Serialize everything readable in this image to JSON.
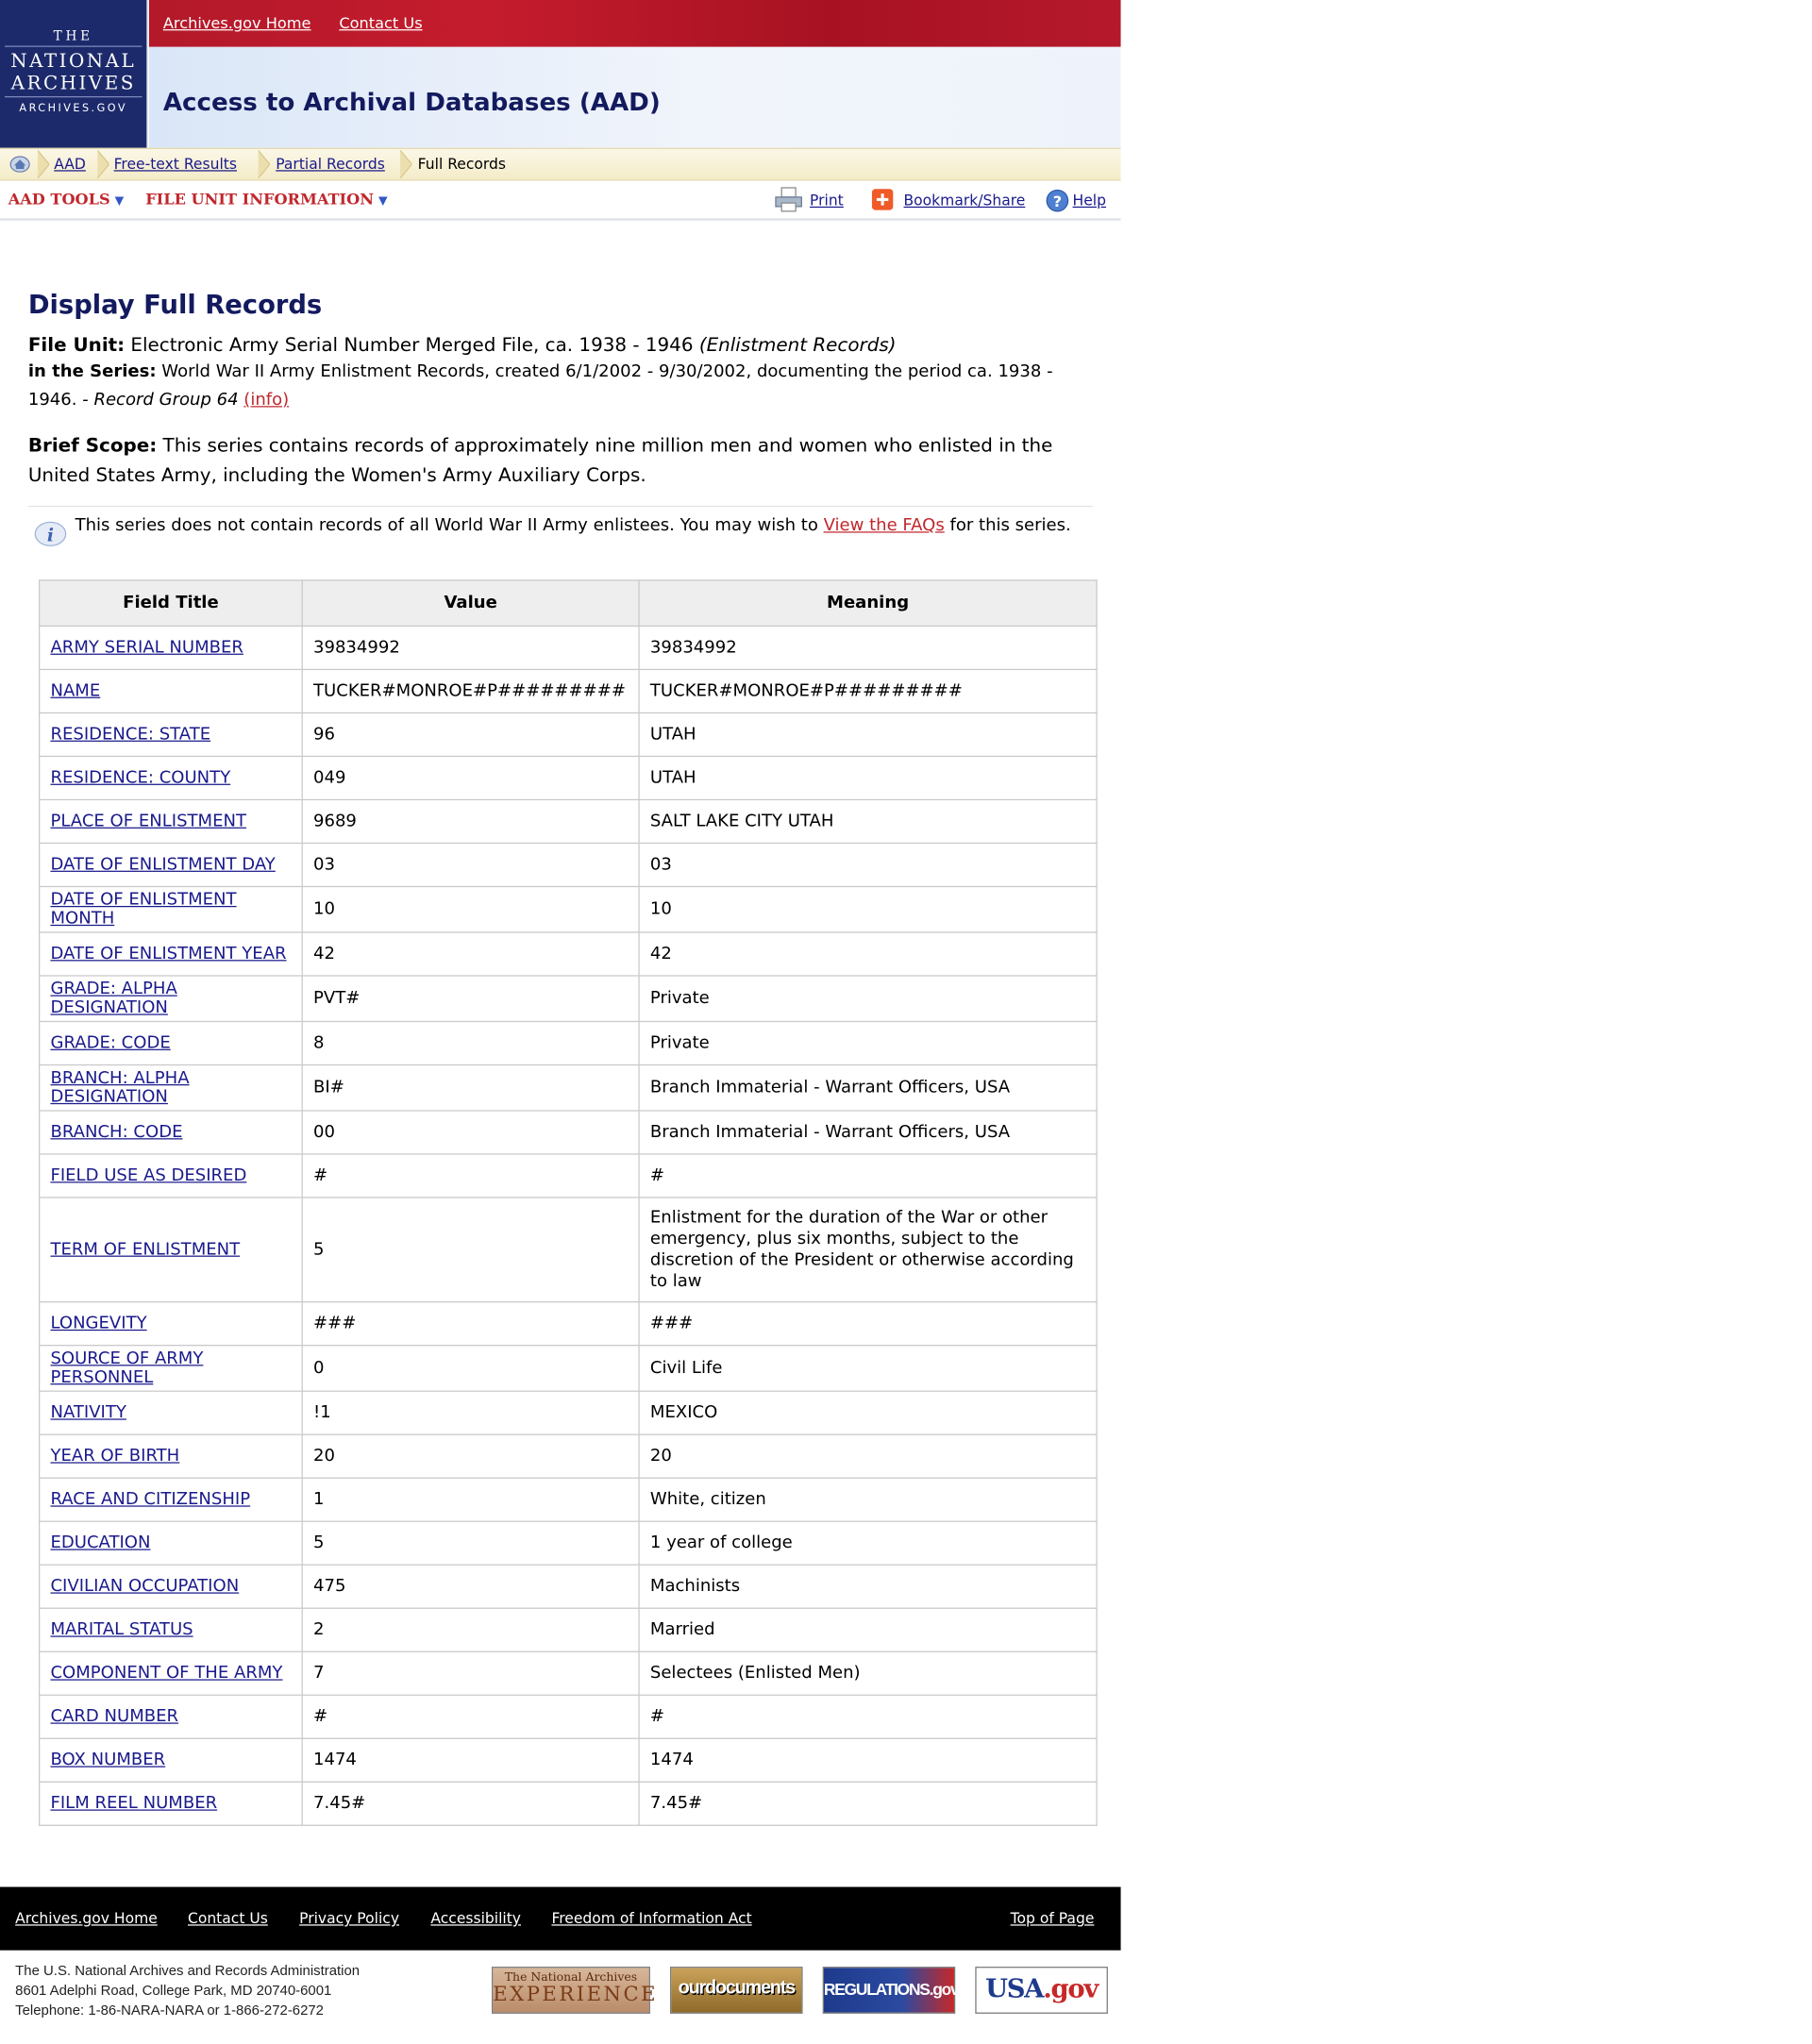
{
  "header": {
    "logo": {
      "line1": "THE",
      "line2a": "NATIONAL",
      "line2b": "ARCHIVES",
      "line3": "ARCHIVES.GOV"
    },
    "top_links": [
      "Archives.gov Home",
      "Contact Us"
    ],
    "site_title": "Access to Archival Databases (AAD)"
  },
  "breadcrumb": [
    "AAD",
    "Free-text Results",
    "Partial Records",
    "Full Records"
  ],
  "toolbar": {
    "aad_tools": "AAD TOOLS",
    "file_unit_info": "FILE UNIT INFORMATION",
    "print": "Print",
    "bookmark": "Bookmark/Share",
    "help": "Help"
  },
  "page": {
    "heading": "Display Full Records",
    "file_unit_label": "File Unit:",
    "file_unit_text": "Electronic Army Serial Number Merged File, ca. 1938 - 1946",
    "file_unit_italic": "(Enlistment Records)",
    "series_label": "in the Series:",
    "series_text": "World War II Army Enlistment Records, created 6/1/2002 - 9/30/2002, documenting the period ca. 1938 - 1946. -",
    "series_italic": "Record Group 64",
    "info_link": "(info)",
    "scope_label": "Brief Scope:",
    "scope_text": "This series contains records of approximately nine million men and women who enlisted in the United States Army, including the Women's Army Auxiliary Corps.",
    "note_before": "This series does not contain records of all World War II Army enlistees. You may wish to",
    "note_link": "View the FAQs",
    "note_after": "for this series."
  },
  "table": {
    "headers": [
      "Field Title",
      "Value",
      "Meaning"
    ],
    "rows": [
      {
        "field": "ARMY SERIAL NUMBER",
        "value": "39834992",
        "meaning": "39834992"
      },
      {
        "field": "NAME",
        "value": "TUCKER#MONROE#P#########",
        "meaning": "TUCKER#MONROE#P#########"
      },
      {
        "field": "RESIDENCE: STATE",
        "value": "96",
        "meaning": "UTAH"
      },
      {
        "field": "RESIDENCE: COUNTY",
        "value": "049",
        "meaning": "UTAH"
      },
      {
        "field": "PLACE OF ENLISTMENT",
        "value": "9689",
        "meaning": "SALT LAKE CITY UTAH"
      },
      {
        "field": "DATE OF ENLISTMENT DAY",
        "value": "03",
        "meaning": "03"
      },
      {
        "field": "DATE OF ENLISTMENT MONTH",
        "value": "10",
        "meaning": "10"
      },
      {
        "field": "DATE OF ENLISTMENT YEAR",
        "value": "42",
        "meaning": "42"
      },
      {
        "field": "GRADE: ALPHA DESIGNATION",
        "value": "PVT#",
        "meaning": "Private"
      },
      {
        "field": "GRADE: CODE",
        "value": "8",
        "meaning": "Private"
      },
      {
        "field": "BRANCH: ALPHA DESIGNATION",
        "value": "BI#",
        "meaning": "Branch Immaterial - Warrant Officers, USA"
      },
      {
        "field": "BRANCH: CODE",
        "value": "00",
        "meaning": "Branch Immaterial - Warrant Officers, USA"
      },
      {
        "field": "FIELD USE AS DESIRED",
        "value": "#",
        "meaning": "#"
      },
      {
        "field": "TERM OF ENLISTMENT",
        "value": "5",
        "meaning": "Enlistment for the duration of the War or other emergency, plus six months, subject to the discretion of the President or otherwise according to law"
      },
      {
        "field": "LONGEVITY",
        "value": "###",
        "meaning": "###"
      },
      {
        "field": "SOURCE OF ARMY PERSONNEL",
        "value": "0",
        "meaning": "Civil Life"
      },
      {
        "field": "NATIVITY",
        "value": "!1",
        "meaning": "MEXICO"
      },
      {
        "field": "YEAR OF BIRTH",
        "value": "20",
        "meaning": "20"
      },
      {
        "field": "RACE AND CITIZENSHIP",
        "value": "1",
        "meaning": "White, citizen"
      },
      {
        "field": "EDUCATION",
        "value": "5",
        "meaning": "1 year of college"
      },
      {
        "field": "CIVILIAN OCCUPATION",
        "value": "475",
        "meaning": "Machinists"
      },
      {
        "field": "MARITAL STATUS",
        "value": "2",
        "meaning": "Married"
      },
      {
        "field": "COMPONENT OF THE ARMY",
        "value": "7",
        "meaning": "Selectees (Enlisted Men)"
      },
      {
        "field": "CARD NUMBER",
        "value": "#",
        "meaning": "#"
      },
      {
        "field": "BOX NUMBER",
        "value": "1474",
        "meaning": "1474"
      },
      {
        "field": "FILM REEL NUMBER",
        "value": "7.45#",
        "meaning": "7.45#"
      }
    ]
  },
  "footer": {
    "links": [
      "Archives.gov Home",
      "Contact Us",
      "Privacy Policy",
      "Accessibility",
      "Freedom of Information Act"
    ],
    "top_of_page": "Top of Page",
    "address": [
      "The U.S. National Archives and Records Administration",
      "8601 Adelphi Road, College Park, MD 20740-6001",
      "Telephone: 1-86-NARA-NARA or 1-866-272-6272"
    ],
    "badges": {
      "experience_top": "The National Archives",
      "experience_bottom": "EXPERIENCE",
      "ourdocuments": "ourdocuments",
      "regulations": "REGULATIONS.gov",
      "usa_prefix": "USA",
      "usa_suffix": ".gov"
    }
  },
  "colors": {
    "navy": "#131a5e",
    "link": "#1a1a8c",
    "red": "#c0272d",
    "logo_bg": "#1c2a6b",
    "topbar": "#b3192a"
  }
}
